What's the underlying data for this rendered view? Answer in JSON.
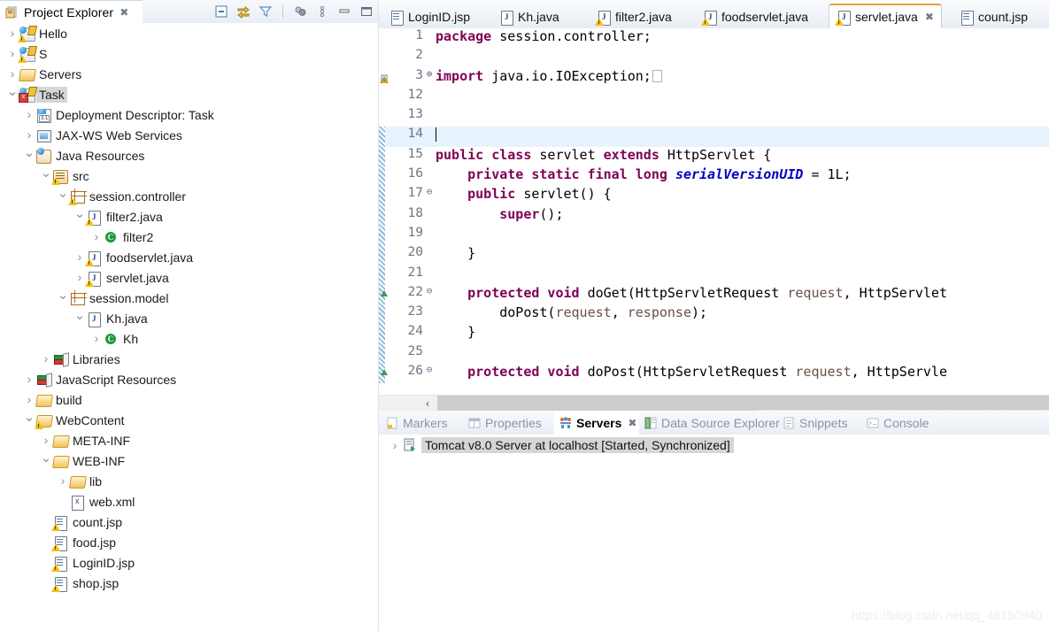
{
  "explorer": {
    "title": "Project Explorer",
    "close_label": "✖",
    "toolbar": [
      {
        "name": "collapse-all-icon",
        "label": "Collapse All"
      },
      {
        "name": "link-with-editor-icon",
        "label": "Link with Editor"
      },
      {
        "name": "filter-icon",
        "label": "Filters"
      },
      {
        "name": "focus-on-active-task-icon",
        "label": "Focus on Active Task"
      },
      {
        "name": "view-menu-icon",
        "label": "View Menu"
      },
      {
        "name": "minimize-icon",
        "label": "Minimize"
      },
      {
        "name": "maximize-icon",
        "label": "Maximize"
      }
    ],
    "tree": [
      {
        "label": "Hello",
        "indent": 0,
        "twist": "closed",
        "icon": "java-project-warn"
      },
      {
        "label": "S",
        "indent": 0,
        "twist": "closed",
        "icon": "java-project-warn"
      },
      {
        "label": "Servers",
        "indent": 0,
        "twist": "closed",
        "icon": "folder"
      },
      {
        "label": "Task",
        "indent": 0,
        "twist": "open",
        "icon": "java-project-error",
        "selected": true
      },
      {
        "label": "Deployment Descriptor: Task",
        "indent": 1,
        "twist": "closed",
        "icon": "deployment-descriptor"
      },
      {
        "label": "JAX-WS Web Services",
        "indent": 1,
        "twist": "closed",
        "icon": "web-services"
      },
      {
        "label": "Java Resources",
        "indent": 1,
        "twist": "open",
        "icon": "java-resources"
      },
      {
        "label": "src",
        "indent": 2,
        "twist": "open",
        "icon": "source-folder"
      },
      {
        "label": "session.controller",
        "indent": 3,
        "twist": "open",
        "icon": "package-warn"
      },
      {
        "label": "filter2.java",
        "indent": 4,
        "twist": "open",
        "icon": "java-file-warn"
      },
      {
        "label": "filter2",
        "indent": 5,
        "twist": "closed",
        "icon": "class"
      },
      {
        "label": "foodservlet.java",
        "indent": 4,
        "twist": "closed",
        "icon": "java-file-warn"
      },
      {
        "label": "servlet.java",
        "indent": 4,
        "twist": "closed",
        "icon": "java-file-warn"
      },
      {
        "label": "session.model",
        "indent": 3,
        "twist": "open",
        "icon": "package"
      },
      {
        "label": "Kh.java",
        "indent": 4,
        "twist": "open",
        "icon": "java-file"
      },
      {
        "label": "Kh",
        "indent": 5,
        "twist": "closed",
        "icon": "class"
      },
      {
        "label": "Libraries",
        "indent": 2,
        "twist": "closed",
        "icon": "libraries"
      },
      {
        "label": "JavaScript Resources",
        "indent": 1,
        "twist": "closed",
        "icon": "libraries"
      },
      {
        "label": "build",
        "indent": 1,
        "twist": "closed",
        "icon": "folder"
      },
      {
        "label": "WebContent",
        "indent": 1,
        "twist": "open",
        "icon": "folder-warn"
      },
      {
        "label": "META-INF",
        "indent": 2,
        "twist": "closed",
        "icon": "folder"
      },
      {
        "label": "WEB-INF",
        "indent": 2,
        "twist": "open",
        "icon": "folder"
      },
      {
        "label": "lib",
        "indent": 3,
        "twist": "closed",
        "icon": "folder"
      },
      {
        "label": "web.xml",
        "indent": 3,
        "twist": "none",
        "icon": "xml-file"
      },
      {
        "label": "count.jsp",
        "indent": 2,
        "twist": "none",
        "icon": "jsp-file-warn"
      },
      {
        "label": "food.jsp",
        "indent": 2,
        "twist": "none",
        "icon": "jsp-file-warn"
      },
      {
        "label": "LoginID.jsp",
        "indent": 2,
        "twist": "none",
        "icon": "jsp-file-warn"
      },
      {
        "label": "shop.jsp",
        "indent": 2,
        "twist": "none",
        "icon": "jsp-file-warn"
      }
    ]
  },
  "editor_tabs": [
    {
      "label": "LoginID.jsp",
      "icon": "jsp-file",
      "active": false
    },
    {
      "label": "Kh.java",
      "icon": "java-file",
      "active": false
    },
    {
      "label": "filter2.java",
      "icon": "java-file-warn",
      "active": false
    },
    {
      "label": "foodservlet.java",
      "icon": "java-file-warn",
      "active": false
    },
    {
      "label": "servlet.java",
      "icon": "java-file-warn",
      "active": true,
      "close_label": "✖"
    },
    {
      "label": "count.jsp",
      "icon": "jsp-file",
      "active": false
    }
  ],
  "code": {
    "lines": [
      {
        "num": "1",
        "fold": "",
        "current": false,
        "changed": false,
        "override": false,
        "warn": false,
        "tokens": [
          {
            "t": "package",
            "c": "k"
          },
          {
            "t": " session.controller;",
            "c": ""
          }
        ]
      },
      {
        "num": "2",
        "fold": "",
        "current": false,
        "changed": false,
        "override": false,
        "warn": false,
        "tokens": []
      },
      {
        "num": "3",
        "fold": "⊕",
        "current": false,
        "changed": false,
        "override": false,
        "warn": true,
        "tokens": [
          {
            "t": "import",
            "c": "k"
          },
          {
            "t": " java.io.IOException;",
            "c": ""
          },
          {
            "t": "",
            "c": "impbox"
          }
        ]
      },
      {
        "num": "12",
        "fold": "",
        "current": false,
        "changed": false,
        "override": false,
        "warn": false,
        "tokens": []
      },
      {
        "num": "13",
        "fold": "",
        "current": false,
        "changed": false,
        "override": false,
        "warn": false,
        "tokens": []
      },
      {
        "num": "14",
        "fold": "",
        "current": true,
        "changed": true,
        "override": false,
        "warn": false,
        "tokens": [
          {
            "t": "",
            "c": "caret"
          }
        ]
      },
      {
        "num": "15",
        "fold": "",
        "current": false,
        "changed": true,
        "override": false,
        "warn": false,
        "tokens": [
          {
            "t": "public class",
            "c": "k"
          },
          {
            "t": " servlet ",
            "c": ""
          },
          {
            "t": "extends",
            "c": "k"
          },
          {
            "t": " HttpServlet {",
            "c": ""
          }
        ]
      },
      {
        "num": "16",
        "fold": "",
        "current": false,
        "changed": true,
        "override": false,
        "warn": false,
        "tokens": [
          {
            "t": "    ",
            "c": ""
          },
          {
            "t": "private static final long",
            "c": "k"
          },
          {
            "t": " ",
            "c": ""
          },
          {
            "t": "serialVersionUID",
            "c": "fieldi"
          },
          {
            "t": " = 1L;",
            "c": ""
          }
        ]
      },
      {
        "num": "17",
        "fold": "⊖",
        "current": false,
        "changed": true,
        "override": false,
        "warn": false,
        "tokens": [
          {
            "t": "    ",
            "c": ""
          },
          {
            "t": "public",
            "c": "k"
          },
          {
            "t": " servlet() {",
            "c": ""
          }
        ]
      },
      {
        "num": "18",
        "fold": "",
        "current": false,
        "changed": true,
        "override": false,
        "warn": false,
        "tokens": [
          {
            "t": "        ",
            "c": ""
          },
          {
            "t": "super",
            "c": "k"
          },
          {
            "t": "();",
            "c": ""
          }
        ]
      },
      {
        "num": "19",
        "fold": "",
        "current": false,
        "changed": true,
        "override": false,
        "warn": false,
        "tokens": []
      },
      {
        "num": "20",
        "fold": "",
        "current": false,
        "changed": true,
        "override": false,
        "warn": false,
        "tokens": [
          {
            "t": "    }",
            "c": ""
          }
        ]
      },
      {
        "num": "21",
        "fold": "",
        "current": false,
        "changed": true,
        "override": false,
        "warn": false,
        "tokens": []
      },
      {
        "num": "22",
        "fold": "⊖",
        "current": false,
        "changed": true,
        "override": true,
        "warn": false,
        "tokens": [
          {
            "t": "    ",
            "c": ""
          },
          {
            "t": "protected void",
            "c": "k"
          },
          {
            "t": " doGet(HttpServletRequest ",
            "c": ""
          },
          {
            "t": "request",
            "c": "param"
          },
          {
            "t": ", HttpServlet",
            "c": ""
          }
        ]
      },
      {
        "num": "23",
        "fold": "",
        "current": false,
        "changed": true,
        "override": false,
        "warn": false,
        "tokens": [
          {
            "t": "        doPost(",
            "c": ""
          },
          {
            "t": "request",
            "c": "param"
          },
          {
            "t": ", ",
            "c": ""
          },
          {
            "t": "response",
            "c": "param"
          },
          {
            "t": ");",
            "c": ""
          }
        ]
      },
      {
        "num": "24",
        "fold": "",
        "current": false,
        "changed": true,
        "override": false,
        "warn": false,
        "tokens": [
          {
            "t": "    }",
            "c": ""
          }
        ]
      },
      {
        "num": "25",
        "fold": "",
        "current": false,
        "changed": true,
        "override": false,
        "warn": false,
        "tokens": []
      },
      {
        "num": "26",
        "fold": "⊖",
        "current": false,
        "changed": true,
        "override": true,
        "warn": false,
        "tokens": [
          {
            "t": "    ",
            "c": ""
          },
          {
            "t": "protected void",
            "c": "k"
          },
          {
            "t": " doPost(HttpServletRequest ",
            "c": ""
          },
          {
            "t": "request",
            "c": "param"
          },
          {
            "t": ", HttpServle",
            "c": ""
          }
        ]
      }
    ],
    "scroll_left_label": "‹"
  },
  "bottom_tabs": [
    {
      "label": "Markers",
      "icon": "markers-icon",
      "active": false
    },
    {
      "label": "Properties",
      "icon": "properties-icon",
      "active": false
    },
    {
      "label": "Servers",
      "icon": "servers-icon",
      "active": true,
      "close_label": "✖"
    },
    {
      "label": "Data Source Explorer",
      "icon": "data-source-explorer-icon",
      "active": false
    },
    {
      "label": "Snippets",
      "icon": "snippets-icon",
      "active": false
    },
    {
      "label": "Console",
      "icon": "console-icon",
      "active": false
    }
  ],
  "servers": {
    "twist": "›",
    "row": "Tomcat v8.0 Server at localhost  [Started, Synchronized]"
  },
  "watermark": "https://blog.csdn.net/qq_46150940",
  "colors": {
    "keyword": "#7f0055",
    "field": "#0000c0",
    "param": "#6a5048",
    "selection": "#d6d6d6",
    "current_line": "#e8f2fe",
    "active_tab_accent": "#e8a33d"
  }
}
